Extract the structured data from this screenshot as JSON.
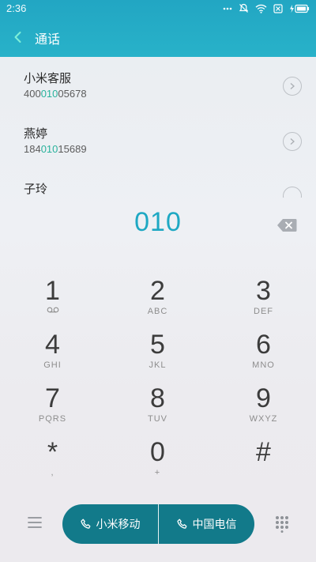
{
  "status": {
    "time": "2:36"
  },
  "header": {
    "title": "通话"
  },
  "contacts": [
    {
      "name": "小米客服",
      "number_pre": "400",
      "number_hl": "010",
      "number_post": "05678"
    },
    {
      "name": "燕婷",
      "number_pre": "184",
      "number_hl": "010",
      "number_post": "15689"
    },
    {
      "name": "子玲",
      "number_pre": "",
      "number_hl": "",
      "number_post": ""
    }
  ],
  "dial": {
    "entered": "010"
  },
  "keys": [
    {
      "digit": "1",
      "sub": ""
    },
    {
      "digit": "2",
      "sub": "ABC"
    },
    {
      "digit": "3",
      "sub": "DEF"
    },
    {
      "digit": "4",
      "sub": "GHI"
    },
    {
      "digit": "5",
      "sub": "JKL"
    },
    {
      "digit": "6",
      "sub": "MNO"
    },
    {
      "digit": "7",
      "sub": "PQRS"
    },
    {
      "digit": "8",
      "sub": "TUV"
    },
    {
      "digit": "9",
      "sub": "WXYZ"
    },
    {
      "digit": "*",
      "sub": ","
    },
    {
      "digit": "0",
      "sub": "+"
    },
    {
      "digit": "#",
      "sub": ""
    }
  ],
  "bottom": {
    "call_sim1": "小米移动",
    "call_sim2": "中国电信"
  },
  "colors": {
    "accent": "#22a6c3",
    "highlight": "#29b29c",
    "call_button": "#127a8a"
  },
  "icons": {
    "back": "chevron-left-icon",
    "voicemail": "voicemail-icon",
    "delete": "backspace-icon",
    "menu": "menu-icon",
    "dialpad": "dialpad-icon",
    "phone": "phone-icon"
  }
}
